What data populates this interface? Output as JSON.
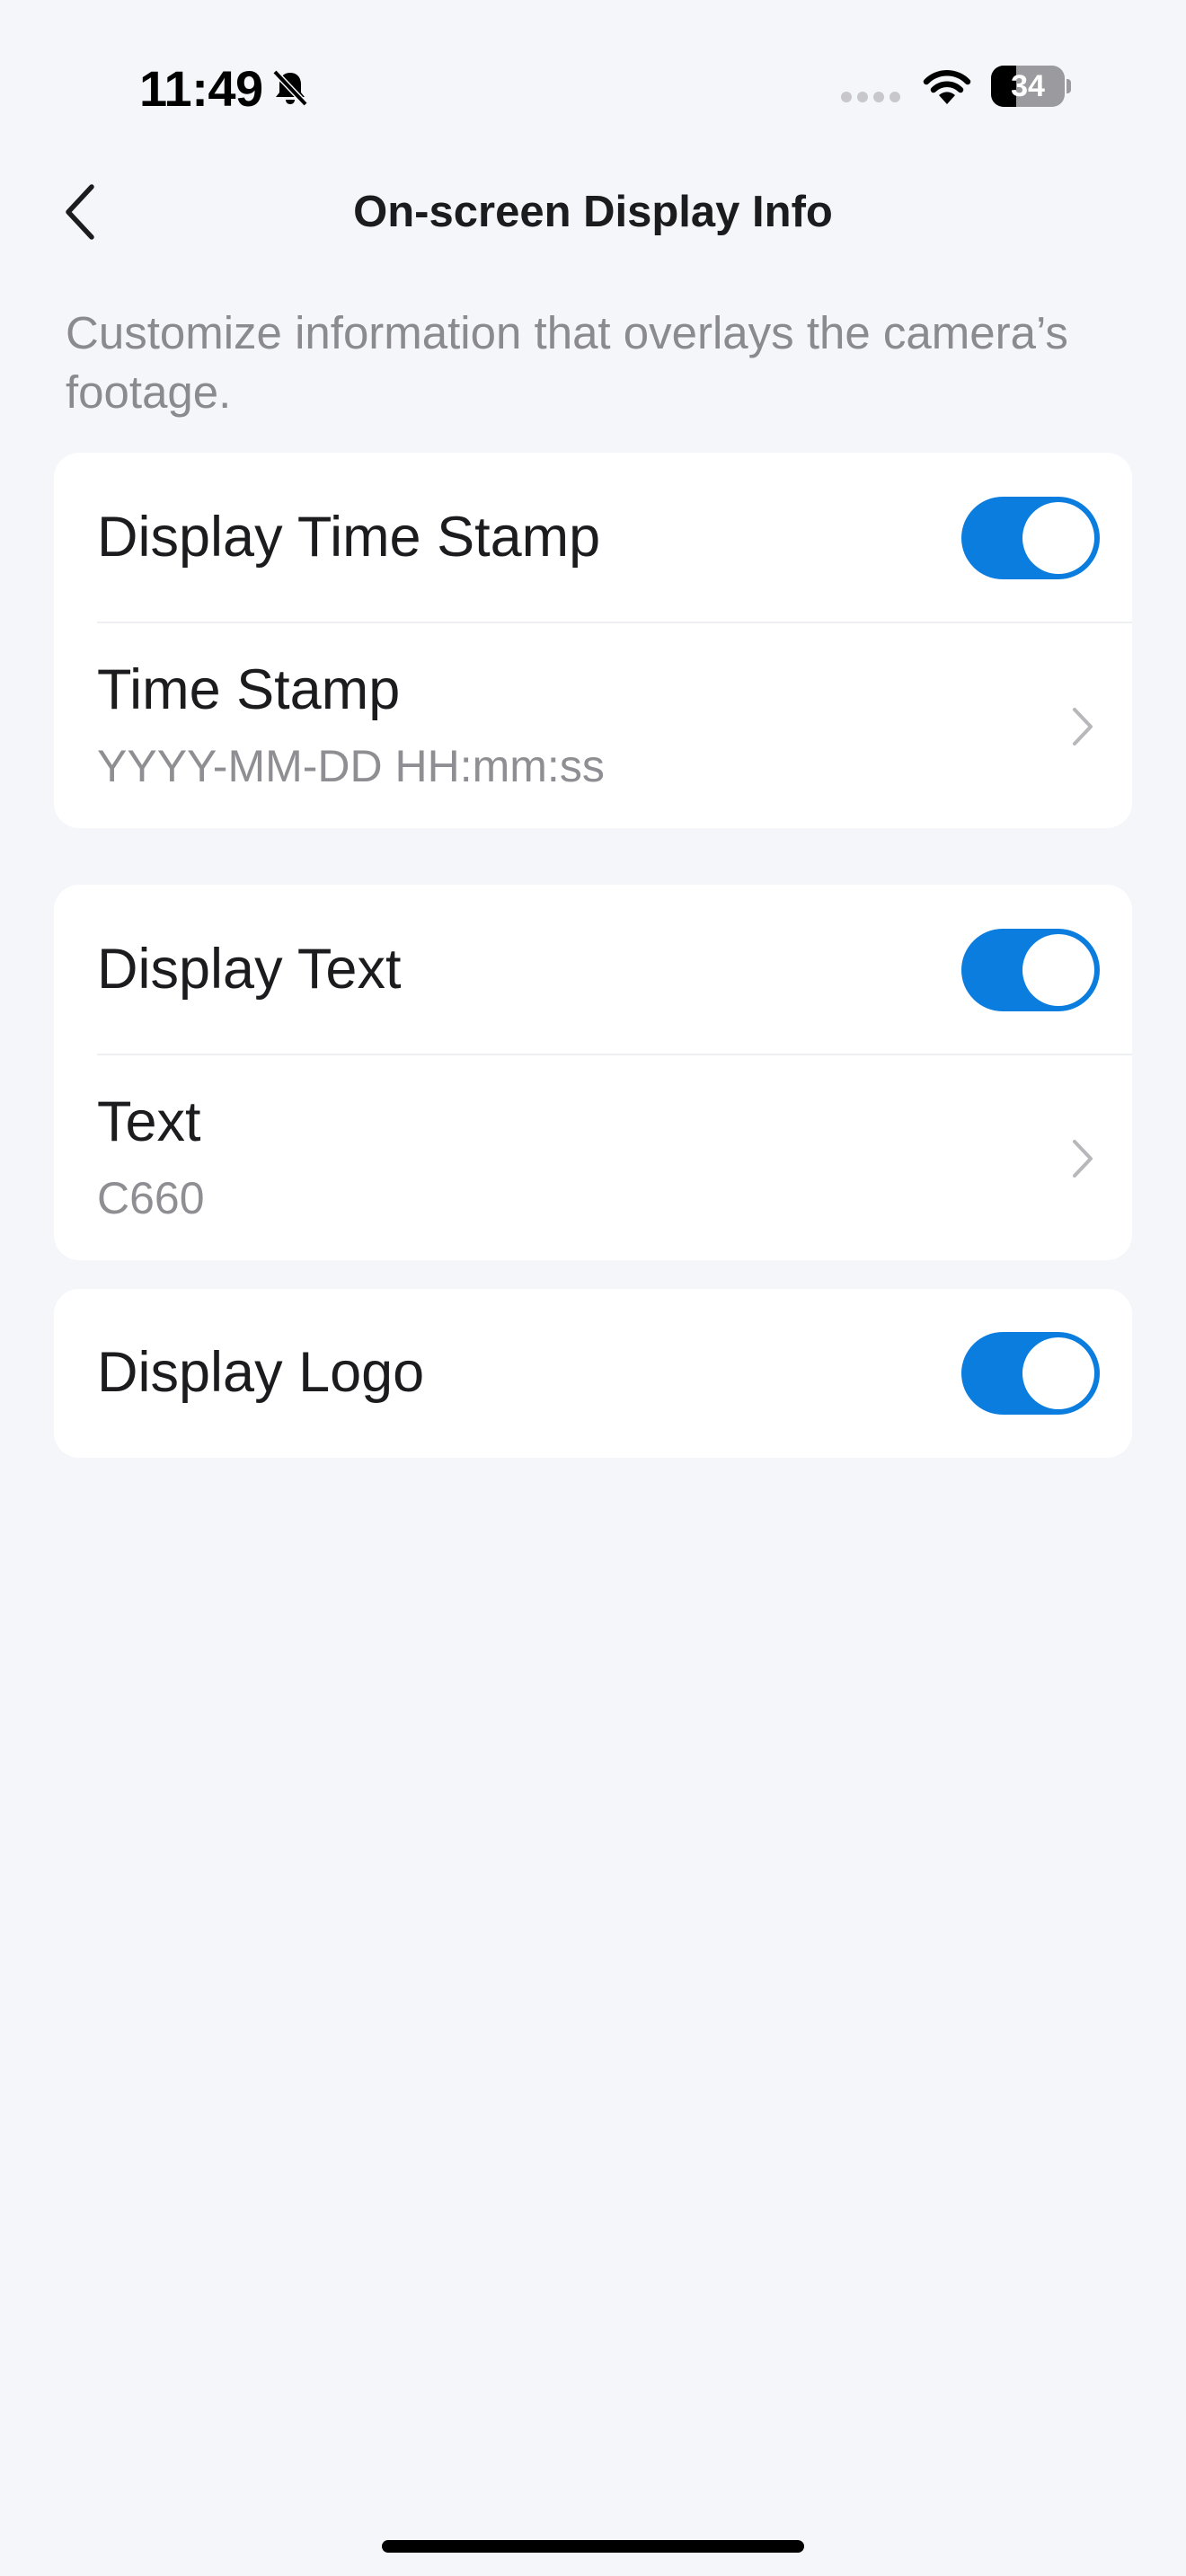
{
  "status_bar": {
    "time": "11:49",
    "battery_level": "34",
    "battery_fraction": 0.34,
    "icons": [
      "bell-slash-icon",
      "signal-dots-icon",
      "wifi-icon",
      "battery-icon"
    ]
  },
  "nav": {
    "title": "On-screen Display Info",
    "back_icon": "chevron-left-icon"
  },
  "description": "Customize information that overlays the camera’s footage.",
  "sections": [
    {
      "rows": [
        {
          "type": "toggle",
          "label": "Display Time Stamp",
          "enabled": true
        },
        {
          "type": "link",
          "label": "Time Stamp",
          "value": "YYYY-MM-DD HH:mm:ss",
          "icon": "chevron-right-icon"
        }
      ]
    },
    {
      "rows": [
        {
          "type": "toggle",
          "label": "Display Text",
          "enabled": true
        },
        {
          "type": "link",
          "label": "Text",
          "value": "C660",
          "icon": "chevron-right-icon"
        }
      ]
    },
    {
      "rows": [
        {
          "type": "toggle",
          "label": "Display Logo",
          "enabled": true
        }
      ]
    }
  ],
  "colors": {
    "accent": "#0a7ddf",
    "background": "#f4f6fa",
    "card": "#ffffff",
    "secondary_text": "#8e8e93"
  }
}
